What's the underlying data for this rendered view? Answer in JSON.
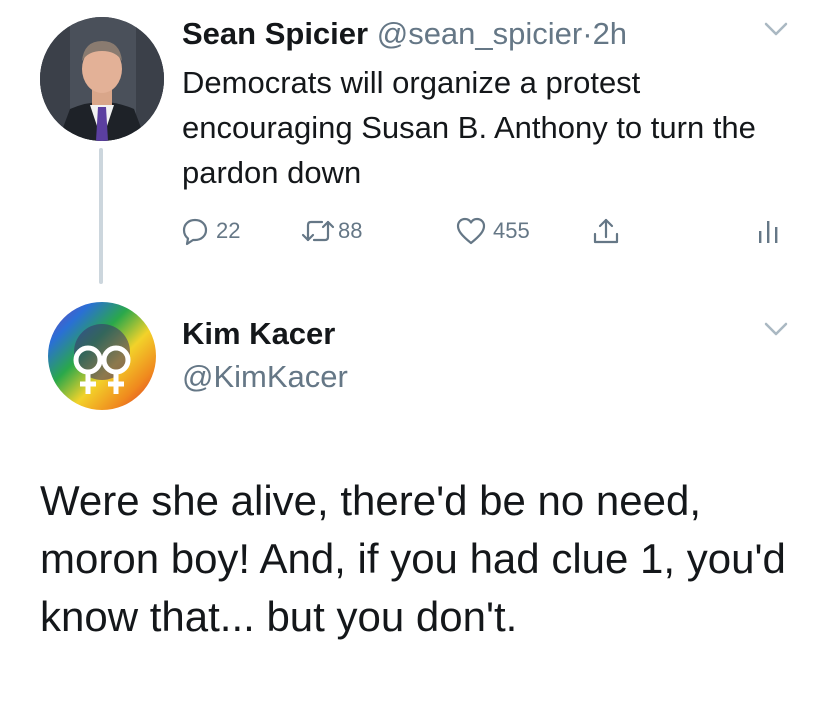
{
  "tweet1": {
    "name": "Sean Spicier",
    "handle": "@sean_spicier",
    "separator": "·",
    "time": "2h",
    "text": "Democrats will organize a protest encouraging Susan B. Anthony to turn the pardon down",
    "replies": "22",
    "retweets": "88",
    "likes": "455",
    "icons": {
      "menu": "chevron-down-icon",
      "reply": "reply-icon",
      "retweet": "retweet-icon",
      "like": "heart-icon",
      "share": "share-icon",
      "analytics": "analytics-icon"
    }
  },
  "tweet2": {
    "name": "Kim Kacer",
    "handle": "@KimKacer",
    "text": "Were she alive, there'd be no need, moron boy! And, if you had clue 1, you'd know that... but you don't.",
    "icons": {
      "menu": "chevron-down-icon"
    }
  },
  "colors": {
    "text": "#14171a",
    "secondary": "#657786",
    "thread_line": "#ccd6dd",
    "chevron": "#aab8c2"
  }
}
